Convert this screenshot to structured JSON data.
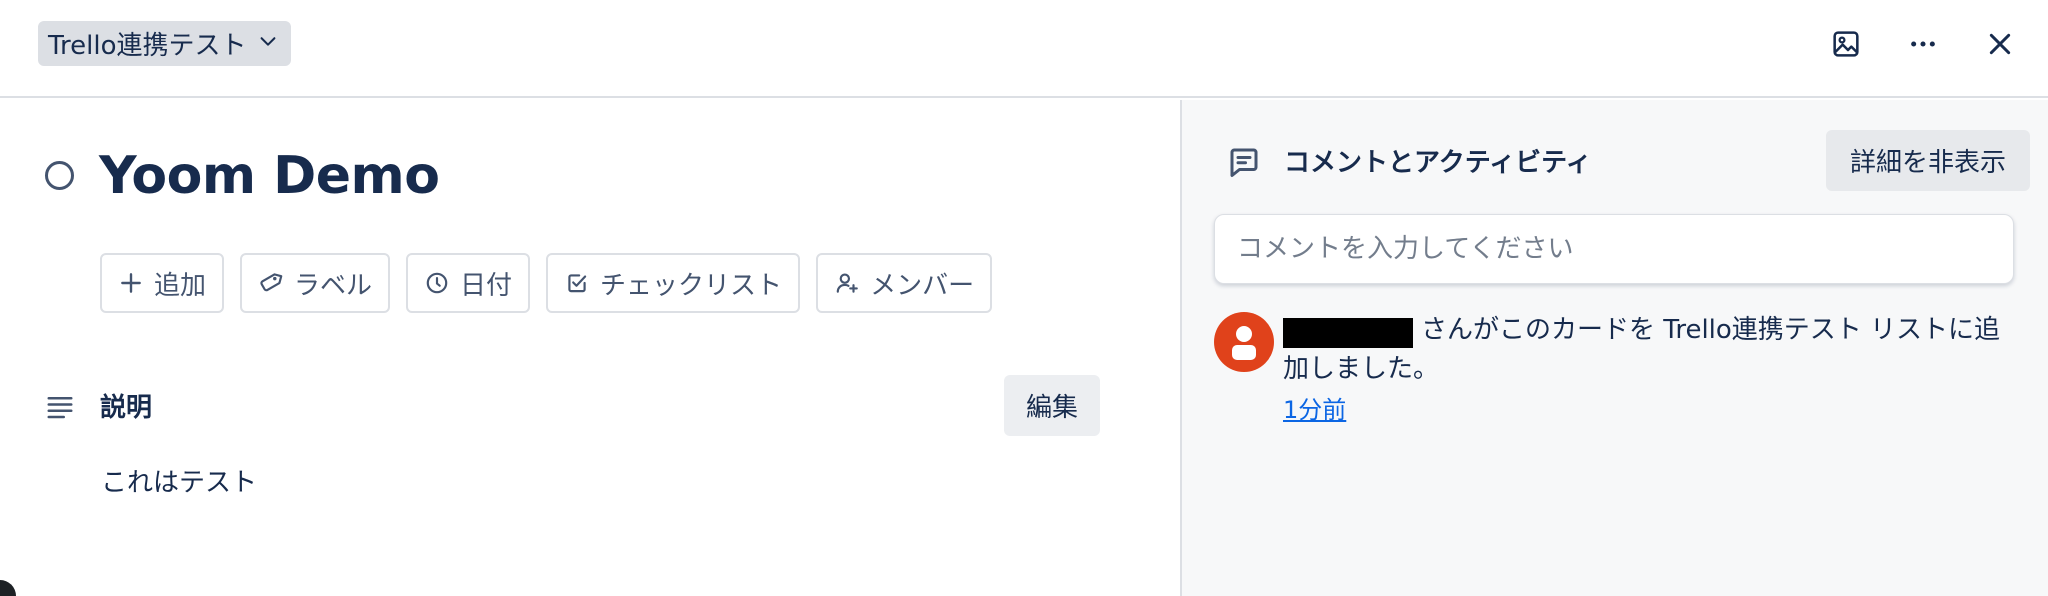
{
  "header": {
    "list_name": "Trello連携テスト",
    "icons": [
      "image-icon",
      "more-icon",
      "close-icon"
    ]
  },
  "card": {
    "title": "Yoom Demo",
    "actions": [
      {
        "label": "追加",
        "icon": "plus-icon"
      },
      {
        "label": "ラベル",
        "icon": "tag-icon"
      },
      {
        "label": "日付",
        "icon": "clock-icon"
      },
      {
        "label": "チェックリスト",
        "icon": "checklist-icon"
      },
      {
        "label": "メンバー",
        "icon": "add-member-icon"
      }
    ],
    "description": {
      "heading": "説明",
      "edit_label": "編集",
      "text": "これはテスト"
    }
  },
  "activity": {
    "heading": "コメントとアクティビティ",
    "hide_details_label": "詳細を非表示",
    "comment_placeholder": "コメントを入力してください",
    "entries": [
      {
        "text": "さんがこのカードを Trello連携テスト リストに追加しました。",
        "time": "1分前"
      }
    ]
  },
  "colors": {
    "accent_link": "#0c66e4",
    "avatar": "#e0421b",
    "sidebar_bg": "#f7f8f9",
    "border": "#dcdfe4"
  }
}
